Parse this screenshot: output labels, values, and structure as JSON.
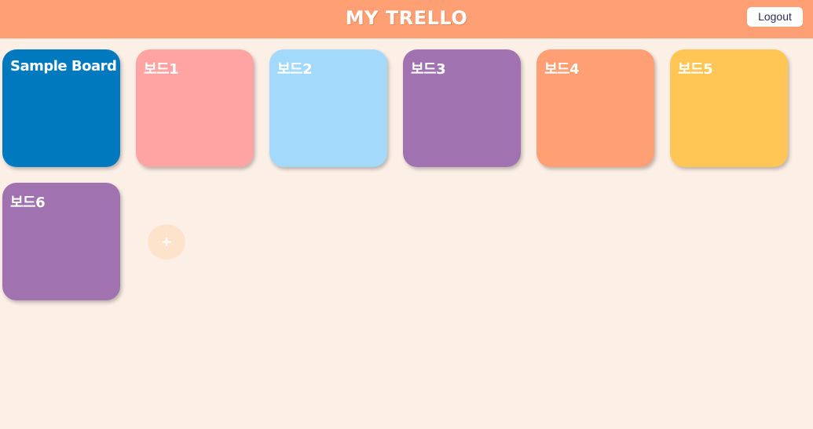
{
  "header": {
    "title": "MY TRELLO",
    "logout_label": "Logout",
    "background": "#ff9f73"
  },
  "boards": [
    {
      "name": "Sample Board",
      "color": "#0079bf"
    },
    {
      "name": "보드1",
      "color": "#ffa3a3"
    },
    {
      "name": "보드2",
      "color": "#a3dafc"
    },
    {
      "name": "보드3",
      "color": "#a073b0"
    },
    {
      "name": "보드4",
      "color": "#ff9f73"
    },
    {
      "name": "보드5",
      "color": "#ffc656"
    },
    {
      "name": "보드6",
      "color": "#a073b0"
    }
  ],
  "add_board": {
    "icon": "plus-icon",
    "label": "+"
  },
  "page_background": "#fcefe6"
}
